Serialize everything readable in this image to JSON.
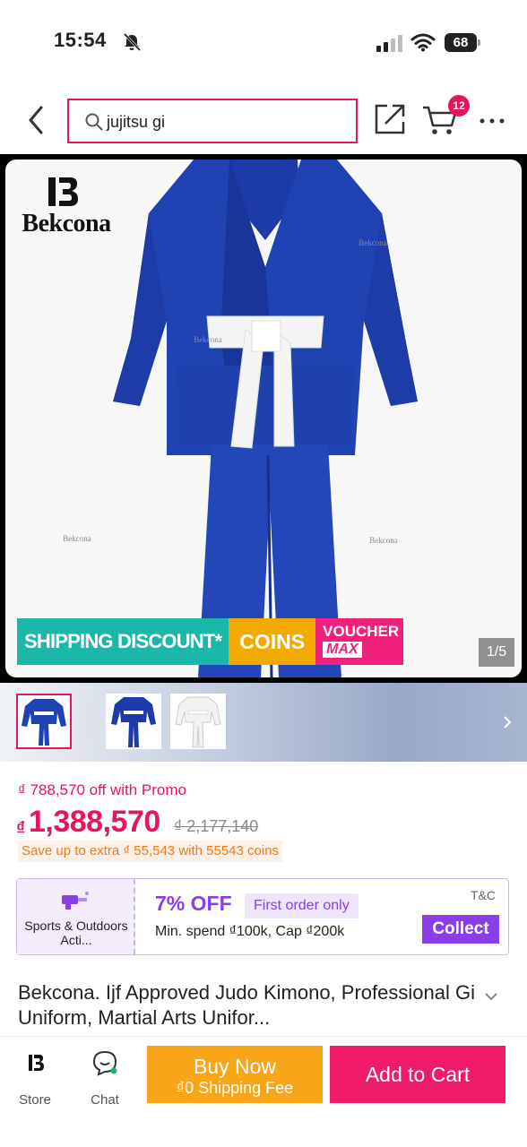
{
  "status_bar": {
    "time": "15:54",
    "battery": "68"
  },
  "search": {
    "query": "jujitsu gi"
  },
  "cart": {
    "badge_count": "12"
  },
  "brand": {
    "name": "Bekcona",
    "watermark": "Bekcona"
  },
  "image": {
    "counter": "1/5",
    "promo": {
      "shipping": "SHIPPING DISCOUNT*",
      "coins": "COINS",
      "voucher_line1": "VOUCHER",
      "voucher_line2": "MAX"
    }
  },
  "thumbnails": [
    {
      "alt": "blue gi with white belt",
      "active": true
    },
    {
      "alt": "blue gi front"
    },
    {
      "alt": "white gi"
    }
  ],
  "price": {
    "promo_text": "₫ 788,570 off with Promo",
    "currency": "₫",
    "current": "1,388,570",
    "original": "₫ 2,177,140",
    "coins_text": "Save up to extra ₫ 55,543 with 55543 coins"
  },
  "voucher": {
    "category": "Sports & Outdoors Acti...",
    "off": "7% OFF",
    "condition": "First order only",
    "spend": "Min. spend ₫100k, Cap ₫200k",
    "tc": "T&C",
    "collect_label": "Collect"
  },
  "product": {
    "title": "Bekcona. Ijf Approved Judo Kimono, Professional Gi Uniform, Martial Arts Unifor..."
  },
  "bottom_bar": {
    "store_label": "Store",
    "chat_label": "Chat",
    "buy_now_label": "Buy Now",
    "buy_now_sub": "₫0 Shipping Fee",
    "add_to_cart_label": "Add to Cart"
  },
  "colors": {
    "accent": "#e5165c",
    "voucher_purple": "#8a3ee8",
    "buy_now": "#f9a51a",
    "add_to_cart": "#ee1c66",
    "gi_blue": "#1e3fae"
  },
  "icons": [
    "bell-muted-icon",
    "signal-icon",
    "wifi-icon",
    "battery-icon",
    "back-arrow-icon",
    "search-icon",
    "share-icon",
    "cart-icon",
    "more-icon",
    "chevron-right-icon",
    "chevron-down-icon",
    "chat-icon",
    "voucher-category-icon"
  ]
}
